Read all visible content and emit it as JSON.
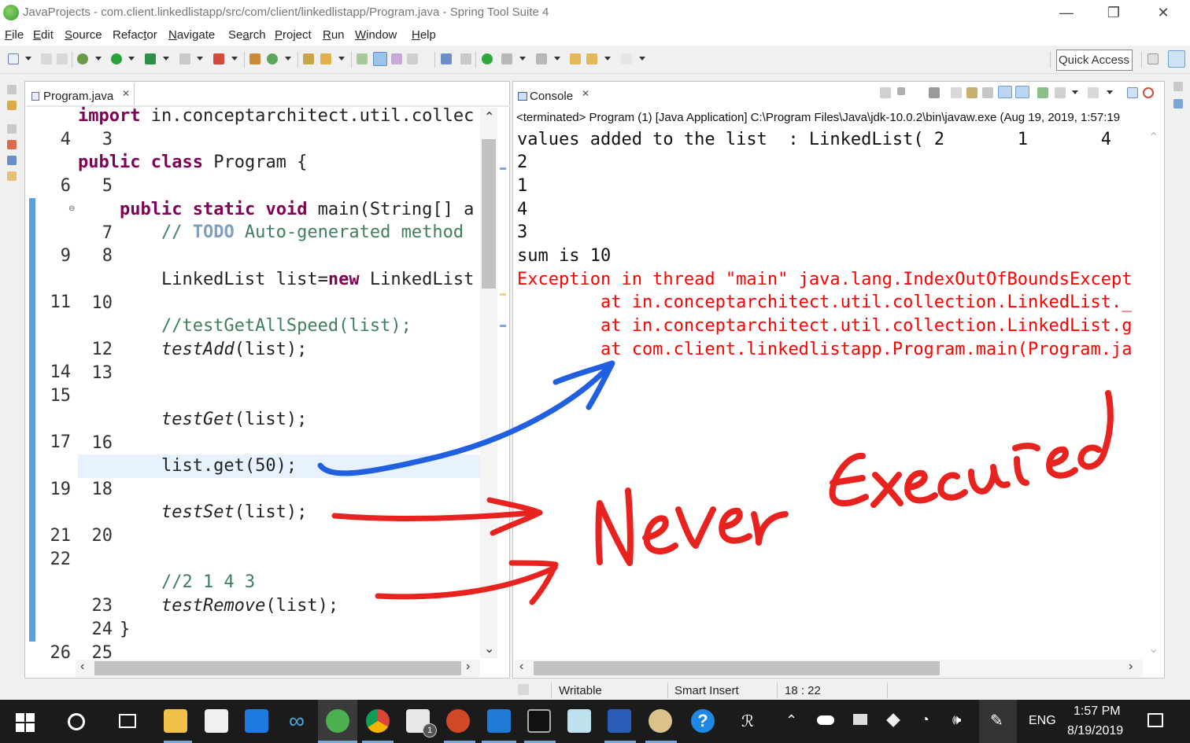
{
  "window": {
    "title": "JavaProjects - com.client.linkedlistapp/src/com/client/linkedlistapp/Program.java - Spring Tool Suite 4",
    "minimize": "—",
    "restore": "❐",
    "close": "✕"
  },
  "menu": [
    {
      "label_u": "F",
      "label_rest": "ile"
    },
    {
      "label_u": "E",
      "label_rest": "dit"
    },
    {
      "label_u": "S",
      "label_rest": "ource"
    },
    {
      "label_u": "",
      "label_rest": "Refac",
      "label_u2": "t",
      "label_rest2": "or"
    },
    {
      "label_u": "N",
      "label_rest": "avigate"
    },
    {
      "label_u": "",
      "label_rest": "Se",
      "label_u2": "a",
      "label_rest2": "rch"
    },
    {
      "label_u": "P",
      "label_rest": "roject"
    },
    {
      "label_u": "R",
      "label_rest": "un"
    },
    {
      "label_u": "W",
      "label_rest": "indow"
    },
    {
      "label_u": "H",
      "label_rest": "elp"
    }
  ],
  "toolbar": {
    "quick_access": "Quick Access"
  },
  "editor": {
    "tab_label": "Program.java",
    "tab_close": "✕",
    "lines": [
      {
        "n": "3",
        "code": "import in.conceptarchitect.util.collec"
      },
      {
        "n": "4",
        "code": ""
      },
      {
        "n": "5",
        "code": "public class Program {"
      },
      {
        "n": "6",
        "code": ""
      },
      {
        "n": "7",
        "code": "    public static void main(String[] a"
      },
      {
        "n": "8",
        "code": "        // TODO Auto-generated method"
      },
      {
        "n": "9",
        "code": ""
      },
      {
        "n": "10",
        "code": "        LinkedList list=new LinkedList"
      },
      {
        "n": "11",
        "code": ""
      },
      {
        "n": "12",
        "code": "        //testGetAllSpeed(list);"
      },
      {
        "n": "13",
        "code": "        testAdd(list);"
      },
      {
        "n": "14",
        "code": ""
      },
      {
        "n": "15",
        "code": ""
      },
      {
        "n": "16",
        "code": "        testGet(list);"
      },
      {
        "n": "17",
        "code": ""
      },
      {
        "n": "18",
        "code": "        list.get(50);"
      },
      {
        "n": "19",
        "code": ""
      },
      {
        "n": "20",
        "code": "        testSet(list);"
      },
      {
        "n": "21",
        "code": ""
      },
      {
        "n": "22",
        "code": ""
      },
      {
        "n": "23",
        "code": "        //2 1 4 3"
      },
      {
        "n": "24",
        "code": "        testRemove(list);"
      },
      {
        "n": "25",
        "code": "    }"
      },
      {
        "n": "26",
        "code": ""
      }
    ]
  },
  "console": {
    "tab_label": "Console",
    "tab_close": "✕",
    "info": "<terminated> Program (1) [Java Application] C:\\Program Files\\Java\\jdk-10.0.2\\bin\\javaw.exe (Aug 19, 2019, 1:57:19",
    "lines": [
      {
        "text": "values added to the list  : LinkedList( 2       1       4",
        "error": false
      },
      {
        "text": "2",
        "error": false
      },
      {
        "text": "1",
        "error": false
      },
      {
        "text": "4",
        "error": false
      },
      {
        "text": "3",
        "error": false
      },
      {
        "text": "sum is 10",
        "error": false
      },
      {
        "text": "Exception in thread \"main\" java.lang.IndexOutOfBoundsExcept",
        "error": true
      },
      {
        "text": "        at in.conceptarchitect.util.collection.LinkedList._",
        "error": true
      },
      {
        "text": "        at in.conceptarchitect.util.collection.LinkedList.g",
        "error": true
      },
      {
        "text": "        at com.client.linkedlistapp.Program.main(Program.ja",
        "error": true
      }
    ]
  },
  "statusbar": {
    "writable": "Writable",
    "insert_mode": "Smart Insert",
    "position": "18 : 22"
  },
  "taskbar": {
    "language": "ENG",
    "time": "1:57 PM",
    "date": "8/19/2019",
    "mail_badge": "1"
  },
  "annotation": {
    "handwritten_text": "Never Executed",
    "ink_colors": {
      "blue": "#1f5fe0",
      "red": "#e8231f"
    }
  },
  "colors": {
    "keyword": "#7f0055",
    "comment": "#3f7f5f",
    "error_text": "#ff0000",
    "current_line": "#e8f2fe"
  }
}
